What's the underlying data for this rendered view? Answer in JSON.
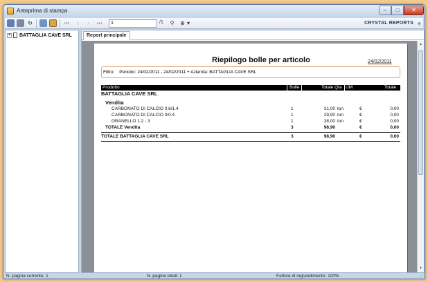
{
  "window": {
    "title": "Anteprima di stampa"
  },
  "toolbar": {
    "page_value": "1",
    "page_total": "/1",
    "brand": "CRYSTAL REPORTS"
  },
  "tree": {
    "root_label": "BATTAGLIA CAVE SRL"
  },
  "tabs": {
    "main": "Report principale"
  },
  "report": {
    "title": "Riepilogo bolle per articolo",
    "date": "24/02/2011",
    "filter_label": "Filtro:",
    "filter_text": "Periodo: 24/02/2011 - 24/02/2011 + Azienda: BATTAGLIA CAVE SRL",
    "columns": {
      "product": "Prodotto",
      "bolle": "Bolle",
      "qty": "Totale Qta",
      "um": "UM",
      "total": "Totale"
    },
    "company": "BATTAGLIA CAVE SRL",
    "group": "Vendita",
    "rows": [
      {
        "product": "CARBONATO DI CALCIO 0.6/1.4",
        "bolle": "1",
        "qty": "31,00",
        "um": "ton",
        "currency": "€",
        "total": "0,00"
      },
      {
        "product": "CARBONATO DI CALCIO 0/0.4",
        "bolle": "1",
        "qty": "29,90",
        "um": "ton",
        "currency": "€",
        "total": "0,00"
      },
      {
        "product": "GRANELLO 1.2 - 3",
        "bolle": "1",
        "qty": "38,00",
        "um": "ton",
        "currency": "€",
        "total": "0,00"
      }
    ],
    "group_total": {
      "label": "TOTALE Vendita",
      "bolle": "3",
      "qty": "98,90",
      "currency": "€",
      "total": "0,00"
    },
    "company_total": {
      "label": "TOTALE BATTAGLIA CAVE SRL",
      "bolle": "3",
      "qty": "98,90",
      "currency": "€",
      "total": "0,00"
    }
  },
  "status": {
    "current_page": "N. pagina corrente: 1",
    "total_pages": "N. pagine totali: 1",
    "zoom": "Fattore di ingrandimento: 100%"
  }
}
